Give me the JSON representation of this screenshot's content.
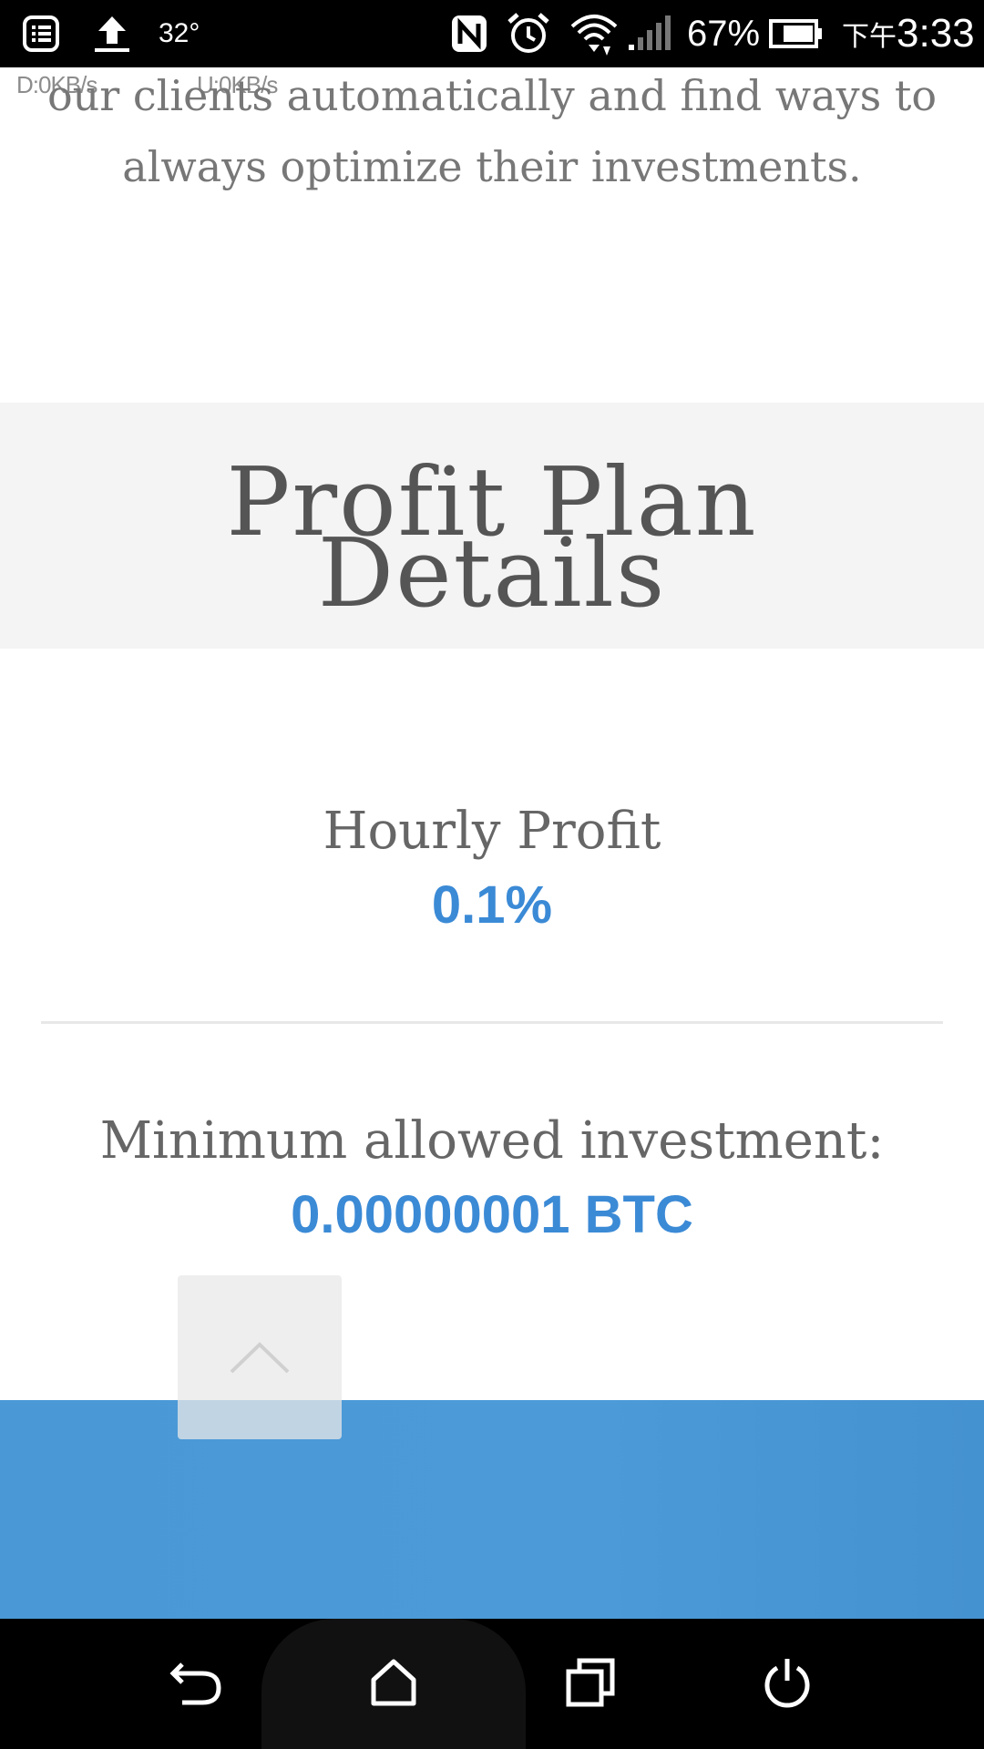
{
  "status_bar": {
    "temperature": "32°",
    "battery_percent": "67%",
    "time_prefix": "下午",
    "time": "3:33",
    "download_speed": "D:0KB/s",
    "upload_speed": "U:0KB/s",
    "icons": [
      "notification-list-icon",
      "upload-icon",
      "nfc-icon",
      "alarm-icon",
      "wifi-icon",
      "signal-icon",
      "battery-icon"
    ]
  },
  "intro": {
    "line1": "our clients automatically and find ways to",
    "line2": "always optimize their investments."
  },
  "plan": {
    "title_line1": "Profit Plan",
    "title_line2": "Details"
  },
  "stats": {
    "hourly_label": "Hourly Profit",
    "hourly_value": "0.1%",
    "min_label": "Minimum allowed investment:",
    "min_value": "0.00000001 BTC"
  },
  "colors": {
    "accent": "#3b8ad6",
    "footer": "#4a98d6",
    "band": "#f4f4f4"
  },
  "nav_bar": {
    "icons": [
      "back-icon",
      "home-icon",
      "recents-icon",
      "power-icon"
    ]
  }
}
